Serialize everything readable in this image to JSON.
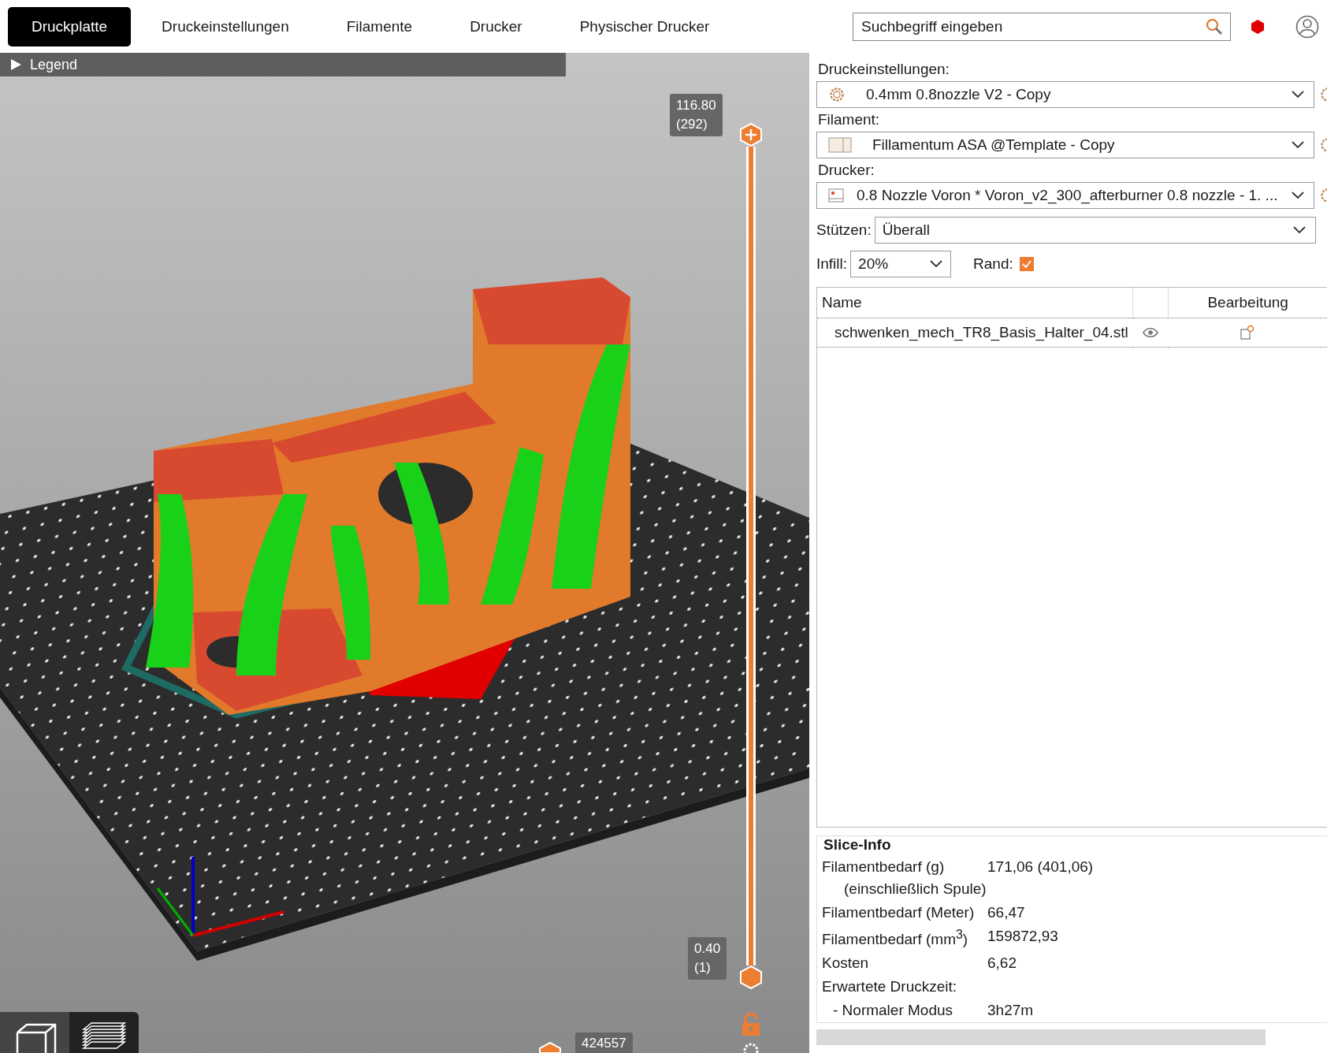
{
  "tabs": [
    {
      "label": "Druckplatte",
      "selected": true
    },
    {
      "label": "Druckeinstellungen",
      "selected": false
    },
    {
      "label": "Filamente",
      "selected": false
    },
    {
      "label": "Drucker",
      "selected": false
    },
    {
      "label": "Physischer Drucker",
      "selected": false
    }
  ],
  "search": {
    "placeholder": "Suchbegriff eingeben"
  },
  "viewport": {
    "legend": {
      "label": "Legend",
      "expanded": false
    },
    "vertical_slider": {
      "upper": {
        "label": "116.80",
        "sub": "(292)",
        "level": 1
      },
      "lower": {
        "label": "0.40",
        "sub": "(1)",
        "level": 0
      }
    },
    "horizontal_slider": {
      "label": "424557"
    },
    "view_buttons": [
      {
        "kind": "model",
        "selected": false
      },
      {
        "kind": "layers",
        "selected": true
      }
    ]
  },
  "presets": [
    {
      "kind": "print",
      "label": "Druckeinstellungen:",
      "value": "0.4mm 0.8nozzle V2 - Copy"
    },
    {
      "kind": "filament",
      "label": "Filament:",
      "value": "Fillamentum ASA @Template - Copy"
    },
    {
      "kind": "printer",
      "label": "Drucker:",
      "value": "0.8 Nozzle Voron  * Voron_v2_300_afterburner 0.8 nozzle - 1. ..."
    }
  ],
  "supports": {
    "label": "Stützen:",
    "value": "Überall"
  },
  "infill": {
    "label": "Infill:",
    "value": "20%"
  },
  "brim": {
    "label": "Rand:",
    "checked": true
  },
  "objects_table": {
    "columns": [
      "Name",
      "Bearbeitung"
    ],
    "rows": [
      {
        "name": "schwenken_mech_TR8_Basis_Halter_04.stl",
        "visible": true
      }
    ]
  },
  "slice_info": {
    "title": "Slice-Info",
    "rows": [
      {
        "kind": "item",
        "label": "Filamentbedarf (g)",
        "note": "(einschließlich Spule)",
        "value": "171,06 (401,06)"
      },
      {
        "kind": "item",
        "label": "Filamentbedarf (Meter)",
        "value": "66,47"
      },
      {
        "kind": "item",
        "label": "Filamentbedarf (mm$^{3}$)",
        "value": "159872,93"
      },
      {
        "kind": "item",
        "label": "Kosten",
        "value": "6,62"
      },
      {
        "kind": "heading",
        "label": "Erwartete Druckzeit:"
      },
      {
        "kind": "subitem",
        "label": "- Normaler Modus",
        "value": "3h27m"
      }
    ]
  }
}
